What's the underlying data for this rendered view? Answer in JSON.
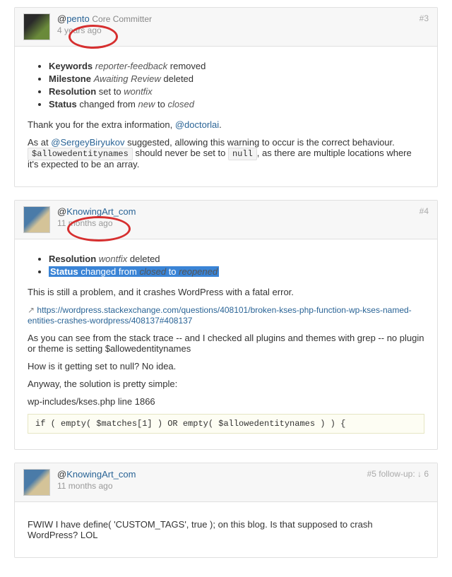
{
  "c3": {
    "num": "#3",
    "authorPrefix": "@",
    "author": "pento",
    "role": "Core Committer",
    "ts": "4 years ago",
    "ch": [
      {
        "k": "Keywords",
        "v": "reporter-feedback",
        "a": "removed"
      },
      {
        "k": "Milestone",
        "v": "Awaiting Review",
        "a": "deleted"
      },
      {
        "k": "Resolution",
        "a": "set to",
        "v": "wontfix"
      },
      {
        "k": "Status",
        "a_pre": "changed from",
        "v1": "new",
        "mid": "to",
        "v2": "closed"
      }
    ],
    "p1_a": "Thank you for the extra information, ",
    "p1_link": "@doctorlai",
    "p1_b": ".",
    "p2_a": "As at ",
    "p2_link": "@SergeyBiryukov",
    "p2_b": " suggested, allowing this warning to occur is the correct behaviour. ",
    "code1": "$allowedentitynames",
    "p2_c": " should never be set to ",
    "code2": "null",
    "p2_d": ", as there are multiple locations where it's expected to be an array."
  },
  "c4": {
    "num": "#4",
    "authorPrefix": "@",
    "author": "KnowingArt_com",
    "ts": "11 months ago",
    "ch_res_k": "Resolution",
    "ch_res_v": "wontfix",
    "ch_res_a": "deleted",
    "ch_st_k": "Status",
    "ch_st_a": "changed from",
    "ch_st_v1": "closed",
    "ch_st_m": "to",
    "ch_st_v2": "reopened",
    "p1": "This is still a problem, and it crashes WordPress with a fatal error.",
    "url": "https://wordpress.stackexchange.com/questions/408101/broken-kses-php-function-wp-kses-named-entities-crashes-wordpress/408137#408137",
    "p2": "As you can see from the stack trace -- and I checked all plugins and themes with grep -- no plugin or theme is setting $allowedentitynames",
    "p3": "How is it getting set to null? No idea.",
    "p4": "Anyway, the solution is pretty simple:",
    "p5": "wp-includes/kses.php line 1866",
    "code": "if ( empty( $matches[1] ) OR empty( $allowedentitynames ) ) {"
  },
  "c5": {
    "num": "#5",
    "fup": "follow-up: ↓ 6",
    "authorPrefix": "@",
    "author": "KnowingArt_com",
    "ts": "11 months ago",
    "p1": "FWIW I have define( 'CUSTOM_TAGS', true ); on this blog. Is that supposed to crash WordPress? LOL"
  }
}
